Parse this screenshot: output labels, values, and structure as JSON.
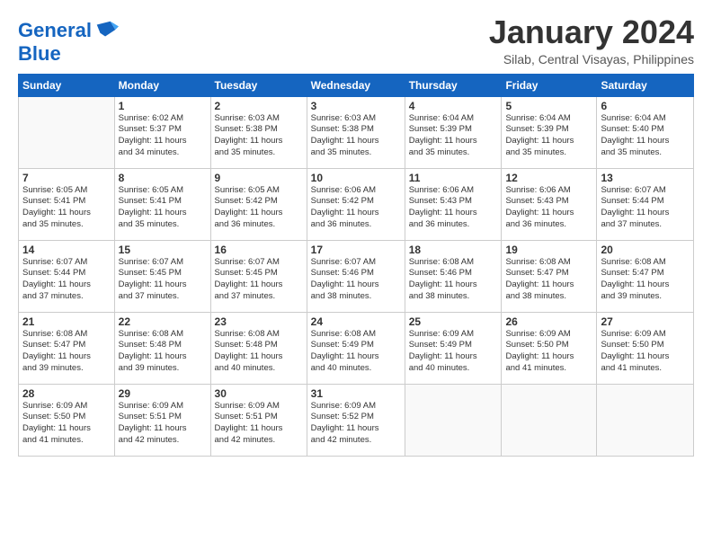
{
  "logo": {
    "line1": "General",
    "line2": "Blue"
  },
  "title": "January 2024",
  "subtitle": "Silab, Central Visayas, Philippines",
  "days_header": [
    "Sunday",
    "Monday",
    "Tuesday",
    "Wednesday",
    "Thursday",
    "Friday",
    "Saturday"
  ],
  "weeks": [
    [
      {
        "day": "",
        "info": ""
      },
      {
        "day": "1",
        "info": "Sunrise: 6:02 AM\nSunset: 5:37 PM\nDaylight: 11 hours\nand 34 minutes."
      },
      {
        "day": "2",
        "info": "Sunrise: 6:03 AM\nSunset: 5:38 PM\nDaylight: 11 hours\nand 35 minutes."
      },
      {
        "day": "3",
        "info": "Sunrise: 6:03 AM\nSunset: 5:38 PM\nDaylight: 11 hours\nand 35 minutes."
      },
      {
        "day": "4",
        "info": "Sunrise: 6:04 AM\nSunset: 5:39 PM\nDaylight: 11 hours\nand 35 minutes."
      },
      {
        "day": "5",
        "info": "Sunrise: 6:04 AM\nSunset: 5:39 PM\nDaylight: 11 hours\nand 35 minutes."
      },
      {
        "day": "6",
        "info": "Sunrise: 6:04 AM\nSunset: 5:40 PM\nDaylight: 11 hours\nand 35 minutes."
      }
    ],
    [
      {
        "day": "7",
        "info": "Sunrise: 6:05 AM\nSunset: 5:41 PM\nDaylight: 11 hours\nand 35 minutes."
      },
      {
        "day": "8",
        "info": "Sunrise: 6:05 AM\nSunset: 5:41 PM\nDaylight: 11 hours\nand 35 minutes."
      },
      {
        "day": "9",
        "info": "Sunrise: 6:05 AM\nSunset: 5:42 PM\nDaylight: 11 hours\nand 36 minutes."
      },
      {
        "day": "10",
        "info": "Sunrise: 6:06 AM\nSunset: 5:42 PM\nDaylight: 11 hours\nand 36 minutes."
      },
      {
        "day": "11",
        "info": "Sunrise: 6:06 AM\nSunset: 5:43 PM\nDaylight: 11 hours\nand 36 minutes."
      },
      {
        "day": "12",
        "info": "Sunrise: 6:06 AM\nSunset: 5:43 PM\nDaylight: 11 hours\nand 36 minutes."
      },
      {
        "day": "13",
        "info": "Sunrise: 6:07 AM\nSunset: 5:44 PM\nDaylight: 11 hours\nand 37 minutes."
      }
    ],
    [
      {
        "day": "14",
        "info": "Sunrise: 6:07 AM\nSunset: 5:44 PM\nDaylight: 11 hours\nand 37 minutes."
      },
      {
        "day": "15",
        "info": "Sunrise: 6:07 AM\nSunset: 5:45 PM\nDaylight: 11 hours\nand 37 minutes."
      },
      {
        "day": "16",
        "info": "Sunrise: 6:07 AM\nSunset: 5:45 PM\nDaylight: 11 hours\nand 37 minutes."
      },
      {
        "day": "17",
        "info": "Sunrise: 6:07 AM\nSunset: 5:46 PM\nDaylight: 11 hours\nand 38 minutes."
      },
      {
        "day": "18",
        "info": "Sunrise: 6:08 AM\nSunset: 5:46 PM\nDaylight: 11 hours\nand 38 minutes."
      },
      {
        "day": "19",
        "info": "Sunrise: 6:08 AM\nSunset: 5:47 PM\nDaylight: 11 hours\nand 38 minutes."
      },
      {
        "day": "20",
        "info": "Sunrise: 6:08 AM\nSunset: 5:47 PM\nDaylight: 11 hours\nand 39 minutes."
      }
    ],
    [
      {
        "day": "21",
        "info": "Sunrise: 6:08 AM\nSunset: 5:47 PM\nDaylight: 11 hours\nand 39 minutes."
      },
      {
        "day": "22",
        "info": "Sunrise: 6:08 AM\nSunset: 5:48 PM\nDaylight: 11 hours\nand 39 minutes."
      },
      {
        "day": "23",
        "info": "Sunrise: 6:08 AM\nSunset: 5:48 PM\nDaylight: 11 hours\nand 40 minutes."
      },
      {
        "day": "24",
        "info": "Sunrise: 6:08 AM\nSunset: 5:49 PM\nDaylight: 11 hours\nand 40 minutes."
      },
      {
        "day": "25",
        "info": "Sunrise: 6:09 AM\nSunset: 5:49 PM\nDaylight: 11 hours\nand 40 minutes."
      },
      {
        "day": "26",
        "info": "Sunrise: 6:09 AM\nSunset: 5:50 PM\nDaylight: 11 hours\nand 41 minutes."
      },
      {
        "day": "27",
        "info": "Sunrise: 6:09 AM\nSunset: 5:50 PM\nDaylight: 11 hours\nand 41 minutes."
      }
    ],
    [
      {
        "day": "28",
        "info": "Sunrise: 6:09 AM\nSunset: 5:50 PM\nDaylight: 11 hours\nand 41 minutes."
      },
      {
        "day": "29",
        "info": "Sunrise: 6:09 AM\nSunset: 5:51 PM\nDaylight: 11 hours\nand 42 minutes."
      },
      {
        "day": "30",
        "info": "Sunrise: 6:09 AM\nSunset: 5:51 PM\nDaylight: 11 hours\nand 42 minutes."
      },
      {
        "day": "31",
        "info": "Sunrise: 6:09 AM\nSunset: 5:52 PM\nDaylight: 11 hours\nand 42 minutes."
      },
      {
        "day": "",
        "info": ""
      },
      {
        "day": "",
        "info": ""
      },
      {
        "day": "",
        "info": ""
      }
    ]
  ]
}
